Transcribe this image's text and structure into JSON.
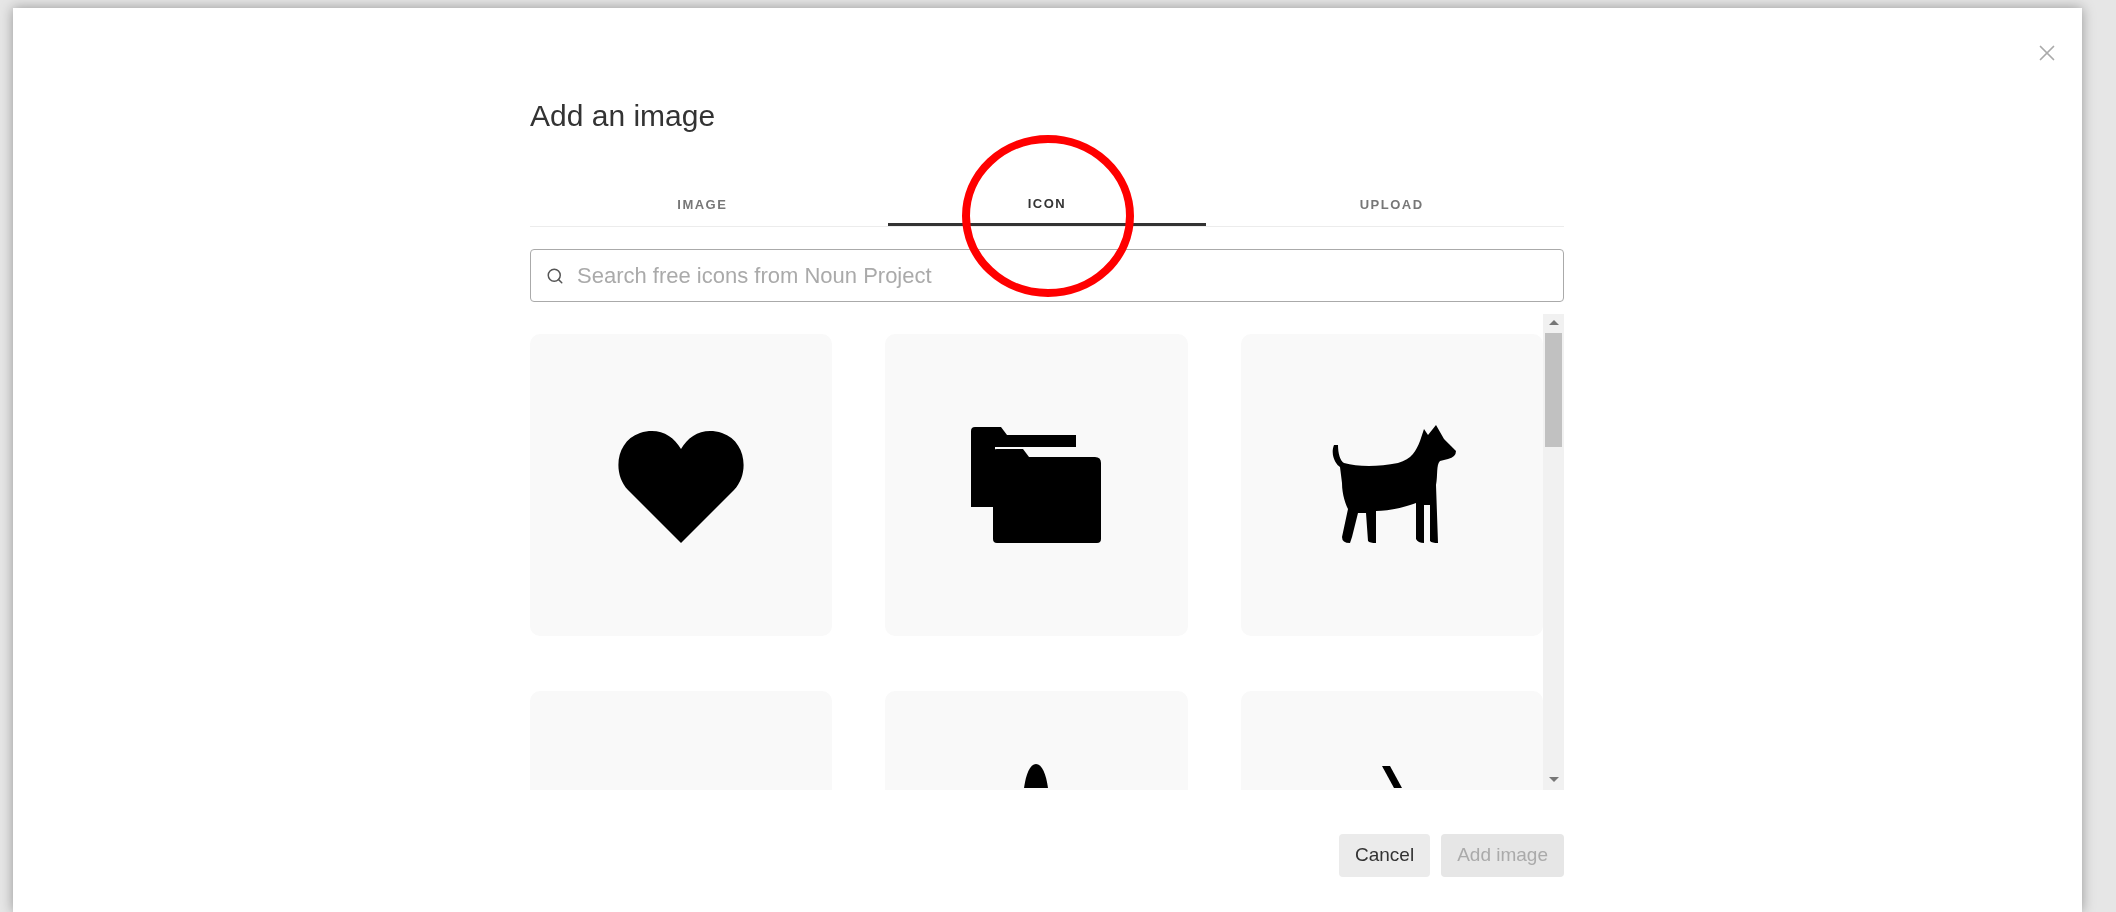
{
  "dialog": {
    "title": "Add an image"
  },
  "tabs": [
    {
      "label": "IMAGE",
      "selected": false
    },
    {
      "label": "ICON",
      "selected": true
    },
    {
      "label": "UPLOAD",
      "selected": false
    }
  ],
  "search": {
    "placeholder": "Search free icons from Noun Project"
  },
  "results": [
    {
      "kind": "heart"
    },
    {
      "kind": "folders"
    },
    {
      "kind": "dog"
    },
    {
      "kind": "blank"
    },
    {
      "kind": "peak"
    },
    {
      "kind": "slash"
    }
  ],
  "buttons": [
    {
      "label": "Cancel",
      "disabled": false
    },
    {
      "label": "Add image",
      "disabled": true
    }
  ]
}
